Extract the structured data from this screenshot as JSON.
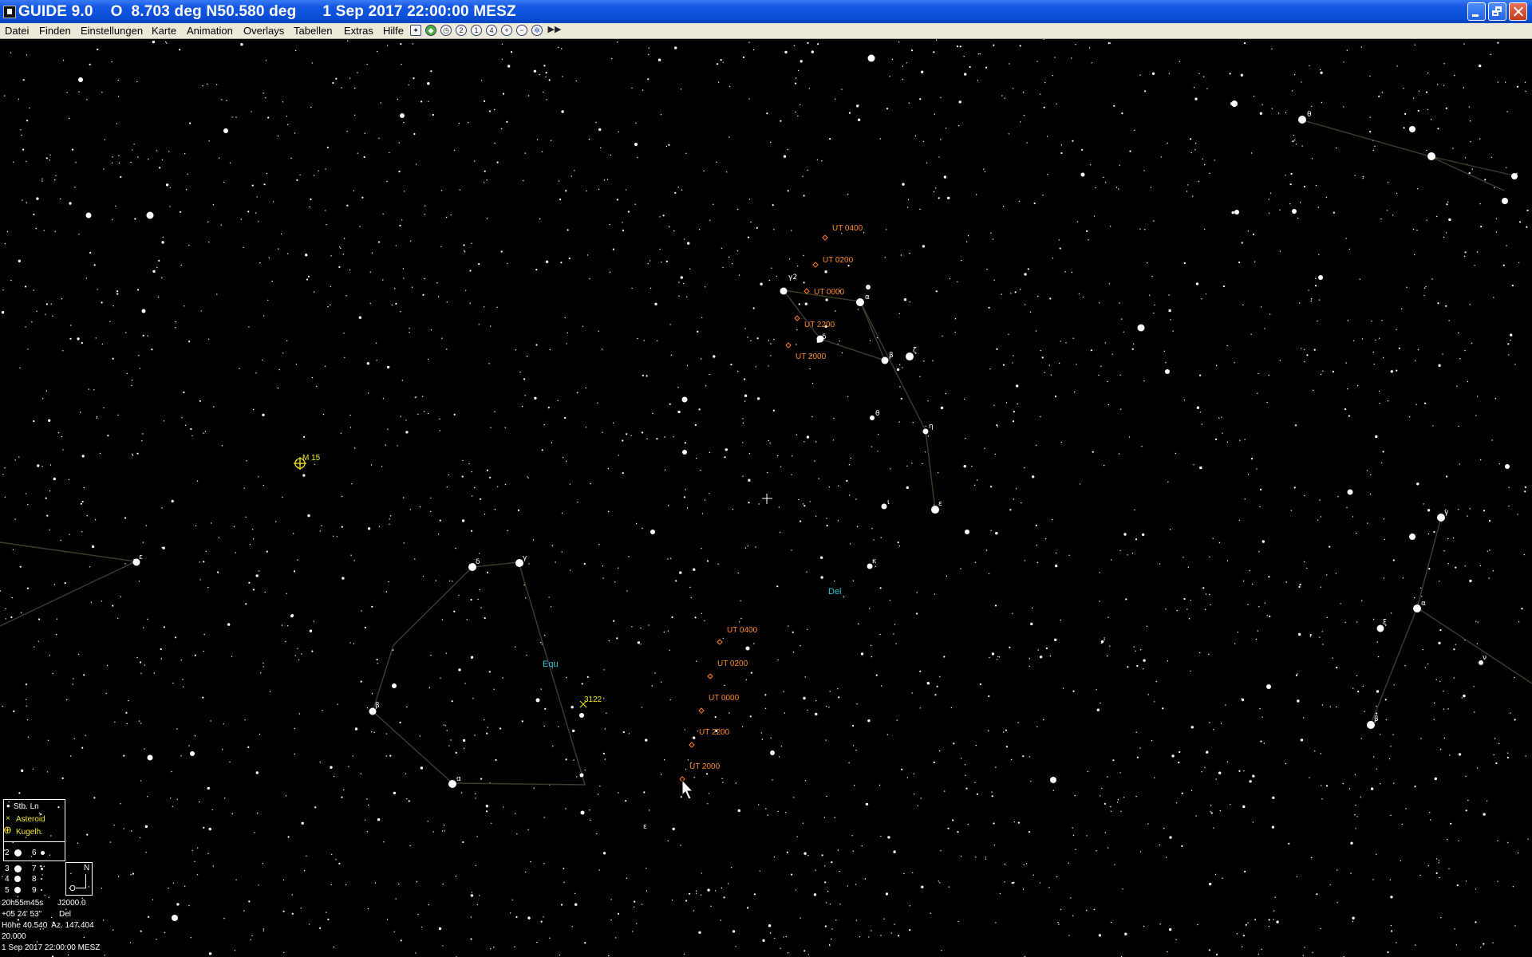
{
  "window": {
    "title": "GUIDE 9.0    O  8.703 deg N50.580 deg      1 Sep 2017 22:00:00 MESZ"
  },
  "menu": [
    "Datei",
    "Finden",
    "Einstellungen",
    "Karte",
    "Animation",
    "Overlays",
    "Tabellen",
    "Extras",
    "Hilfe"
  ],
  "toolbar_icons": [
    "map-icon",
    "green-planet-icon",
    "clock-icon",
    "zoom-2-icon",
    "zoom-1-icon",
    "zoom-4-icon",
    "zoom-in-icon",
    "zoom-out-icon",
    "star-grid-icon",
    "fast-forward-icon"
  ],
  "toolbar_glyphs": [
    "✦",
    "◆",
    "◷",
    "2",
    "1",
    "4",
    "+",
    "−",
    "✲",
    "▶▶"
  ],
  "colors": {
    "title_bar": "#0a4fd8",
    "chart_background": "#000000",
    "stars": "#ffffff",
    "comet_track": "#ff7a1a",
    "constellation_name": "#2bc4d8",
    "deep_sky": "#f2e81c",
    "constellation_lines": "#3d3d2e"
  },
  "chart": {
    "constellations": [
      "Del",
      "Equ"
    ],
    "deep_sky": "M 15",
    "asteroid": "3122",
    "greek": [
      "γ2",
      "α",
      "δ",
      "β",
      "ζ",
      "θ",
      "η",
      "ε",
      "ι",
      "κ",
      "δ",
      "γ",
      "α",
      "β",
      "ε",
      "β",
      "α",
      "γ",
      "ξ",
      "θ",
      "ε",
      "ν"
    ],
    "track_upper": [
      "UT 0400",
      "UT 0200",
      "UT 0000",
      "UT 2200",
      "UT 2000"
    ],
    "track_lower": [
      "UT 0400",
      "UT 0200",
      "UT 0000",
      "UT 2200",
      "UT 2000"
    ]
  },
  "legend": {
    "title": "Stb. Ln",
    "asteroid_label": "Asteroid",
    "globular_label": "Kugelh.",
    "magnitudes": [
      "2",
      "6",
      "3",
      "7",
      "4",
      "8",
      "5",
      "9"
    ],
    "compass_n": "N",
    "compass_o": "O"
  },
  "status": {
    "ra": "20h55m45s",
    "epoch": "J2000.0",
    "dec": "+05 24' 53\"",
    "constellation": "Del",
    "altaz": "Höhe 40.540  Az. 147.404",
    "fov": "20.000",
    "datetime": "1 Sep 2017 22:00:00 MESZ"
  }
}
